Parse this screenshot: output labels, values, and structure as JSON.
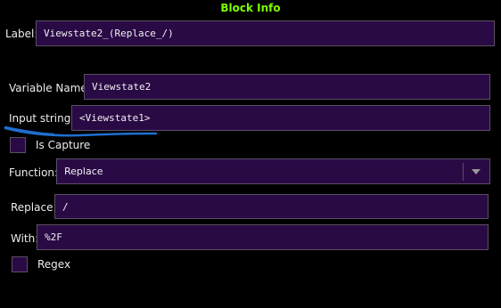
{
  "panel": {
    "title": "Block Info"
  },
  "label": {
    "caption": "Label:",
    "value": "Viewstate2_(Replace_/)"
  },
  "variable_name": {
    "caption": "Variable Name:",
    "value": "Viewstate2"
  },
  "input_string": {
    "caption": "Input string:",
    "value": "<Viewstate1>"
  },
  "is_capture": {
    "caption": "Is Capture",
    "checked": false
  },
  "function": {
    "caption": "Function:",
    "selected": "Replace"
  },
  "replace": {
    "caption": "Replace:",
    "value": "/"
  },
  "with": {
    "caption": "With:",
    "value": "%2F"
  },
  "regex": {
    "caption": "Regex",
    "checked": false
  },
  "colors": {
    "background": "#000000",
    "title": "#7cfc00",
    "field_bg": "#2a0a45",
    "field_border": "#5a4f62",
    "annotation": "#1f6fd1"
  }
}
